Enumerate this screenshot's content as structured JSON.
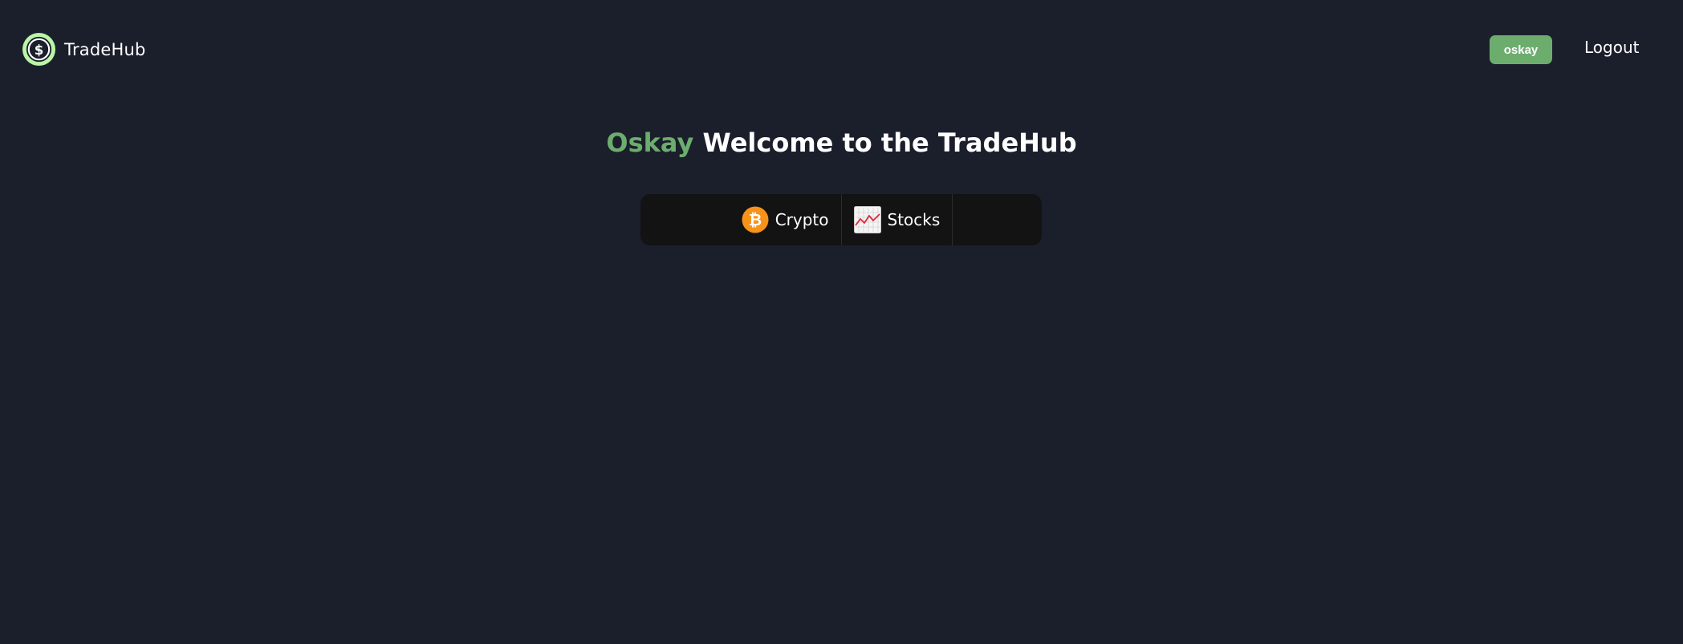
{
  "header": {
    "brand_name": "TradeHub",
    "user_badge": "oskay",
    "logout_label": "Logout"
  },
  "welcome": {
    "username": "Oskay",
    "message": "Welcome to the TradeHub"
  },
  "tabs": [
    {
      "label": "Crypto",
      "icon": "bitcoin-icon"
    },
    {
      "label": "Stocks",
      "icon": "stock-chart-icon"
    }
  ],
  "colors": {
    "background": "#1b1f2c",
    "accent_green": "#6cad6e",
    "tabbar_background": "#131313",
    "bitcoin_orange": "#f7931a",
    "logo_ring": "#b9f5a6"
  }
}
